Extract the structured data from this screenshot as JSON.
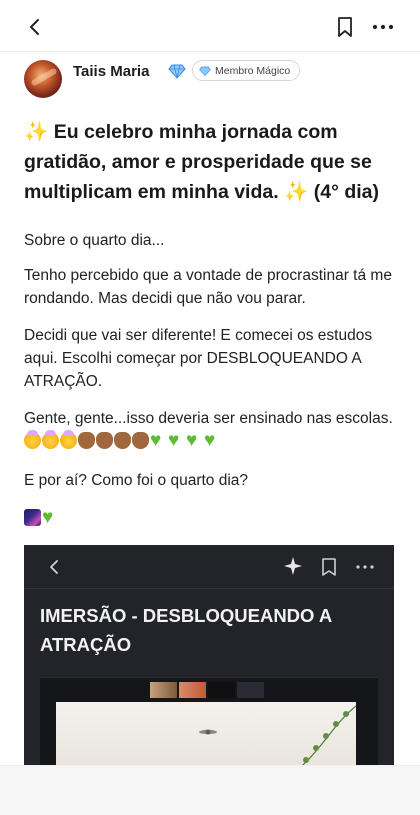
{
  "header": {
    "back": "back",
    "bookmark": "bookmark",
    "more": "more"
  },
  "author": {
    "name": "Taiis Maria",
    "verified_icon": "gem-icon",
    "badge_label": "Membro Mágico"
  },
  "post": {
    "title_spark_left": "✨",
    "title_text": " Eu celebro minha jornada com gratidão, amor e prosperidade que se multiplicam em minha vida. ",
    "title_spark_right": "✨",
    "title_suffix": " (4° dia)",
    "p1": "Sobre o quarto dia...",
    "p2": " Tenho percebido que a vontade de procrastinar tá me rondando. Mas decidi que não vou parar.",
    "p3": "Decidi que vai ser diferente! E comecei os estudos aqui. Escolhi começar por DESBLOQUEANDO A ATRAÇÃO.",
    "p4": "Gente, gente...isso deveria ser ensinado nas escolas.",
    "p4_emojis": [
      "exploding-head",
      "exploding-head",
      "exploding-head",
      "clapping-hands",
      "clapping-hands",
      "clapping-hands",
      "clapping-hands",
      "green-heart",
      "green-heart",
      "green-heart",
      "green-heart"
    ],
    "p5": "E por aí? Como foi o quarto dia?",
    "p6_emojis": [
      "milky-way",
      "green-heart"
    ]
  },
  "screenshot": {
    "title": "IMERSÃO - DESBLOQUEANDO A ATRAÇÃO",
    "colors": {
      "background": "#23242a",
      "text": "#f2f2f2"
    }
  },
  "colors": {
    "accent_gold": "#f2b31a",
    "text": "#1c1c1e",
    "heart_green": "#5dbb34"
  }
}
